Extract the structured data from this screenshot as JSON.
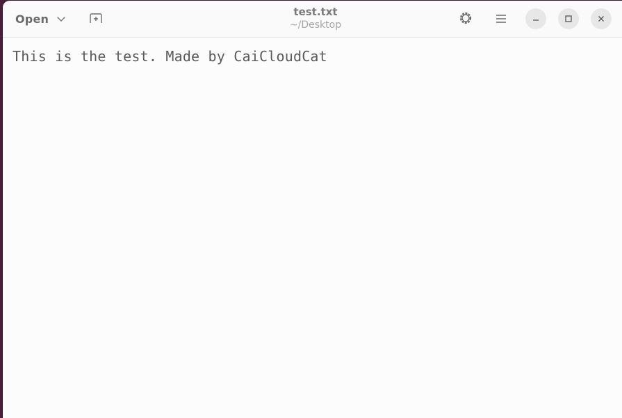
{
  "window": {
    "title": "test.txt",
    "subtitle": "~/Desktop"
  },
  "toolbar": {
    "open_label": "Open",
    "open_dropdown_icon": "chevron-down-icon",
    "new_document_icon": "new-tab-icon",
    "settings_icon": "gear-icon",
    "menu_icon": "hamburger-menu-icon"
  },
  "window_controls": {
    "minimize_icon": "minimize-icon",
    "maximize_icon": "maximize-icon",
    "close_icon": "close-icon"
  },
  "editor": {
    "content": "This is the test. Made by CaiCloudCat"
  },
  "colors": {
    "desktop_background": "#4a1f3b",
    "window_background": "#fcfcfc",
    "text": "#5a5a5a"
  }
}
